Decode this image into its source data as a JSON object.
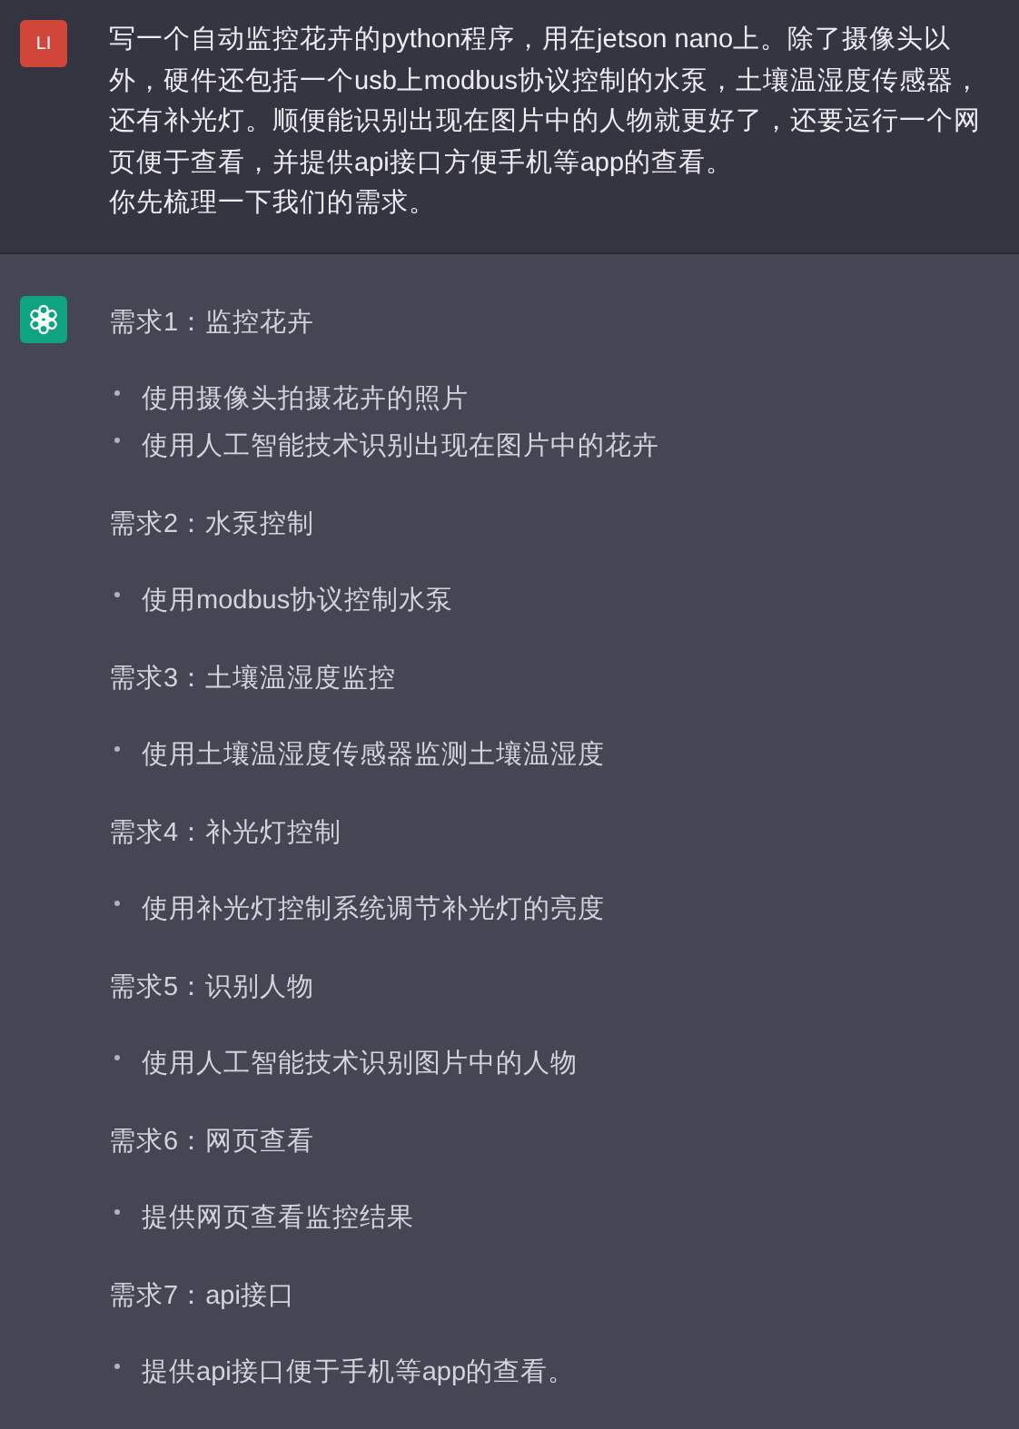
{
  "user_message": {
    "avatar": "LI",
    "lines": [
      "写一个自动监控花卉的python程序，用在jetson nano上。除了摄像头以外，硬件还包括一个usb上modbus协议控制的水泵，土壤温湿度传感器，还有补光灯。顺便能识别出现在图片中的人物就更好了，还要运行一个网页便于查看，并提供api接口方便手机等app的查看。",
      "你先梳理一下我们的需求。"
    ]
  },
  "assistant_message": {
    "sections": [
      {
        "heading": "需求1：监控花卉",
        "items": [
          "使用摄像头拍摄花卉的照片",
          "使用人工智能技术识别出现在图片中的花卉"
        ]
      },
      {
        "heading": "需求2：水泵控制",
        "items": [
          "使用modbus协议控制水泵"
        ]
      },
      {
        "heading": "需求3：土壤温湿度监控",
        "items": [
          "使用土壤温湿度传感器监测土壤温湿度"
        ]
      },
      {
        "heading": "需求4：补光灯控制",
        "items": [
          "使用补光灯控制系统调节补光灯的亮度"
        ]
      },
      {
        "heading": "需求5：识别人物",
        "items": [
          "使用人工智能技术识别图片中的人物"
        ]
      },
      {
        "heading": "需求6：网页查看",
        "items": [
          "提供网页查看监控结果"
        ]
      },
      {
        "heading": "需求7：api接口",
        "items": [
          "提供api接口便于手机等app的查看。"
        ]
      }
    ]
  }
}
